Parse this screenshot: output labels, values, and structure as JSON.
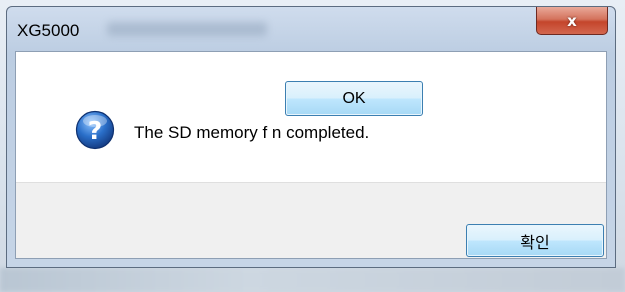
{
  "window": {
    "title": "XG5000",
    "close_glyph": "x"
  },
  "dialog": {
    "icon": "question-icon",
    "message": "The SD memory f                  n completed.",
    "confirm_label": "확인"
  },
  "overlay_button": {
    "label": "OK"
  },
  "colors": {
    "close_button": "#c4452b",
    "button_border": "#3c7fb1",
    "footer_bg": "#f0f0f0",
    "icon_blue": "#2a6fc9"
  }
}
